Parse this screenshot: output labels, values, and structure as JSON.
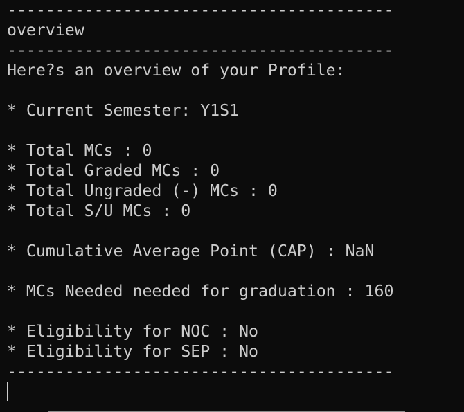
{
  "terminal": {
    "separator_top": "----------------------------------------",
    "heading": "overview",
    "separator_mid": "----------------------------------------",
    "intro": "Here?s an overview of your Profile:",
    "current_semester": "* Current Semester: Y1S1",
    "total_mcs": "* Total MCs : 0",
    "total_graded_mcs": "* Total Graded MCs : 0",
    "total_ungraded_mcs": "* Total Ungraded (-) MCs : 0",
    "total_su_mcs": "* Total S/U MCs : 0",
    "cap": "* Cumulative Average Point (CAP) : NaN",
    "mcs_needed": "* MCs Needed needed for graduation : 160",
    "noc_eligibility": "* Eligibility for NOC : No",
    "sep_eligibility": "* Eligibility for SEP : No",
    "separator_bottom": "----------------------------------------"
  }
}
